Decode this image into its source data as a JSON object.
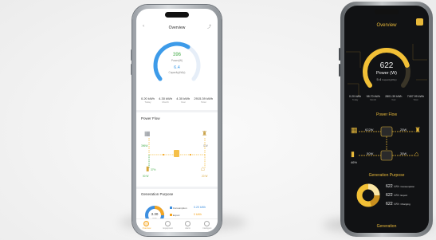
{
  "light_app": {
    "title": "Overview",
    "gauge": {
      "power_value": "396",
      "power_label": "Power(W)",
      "capacity_value": "6.4",
      "capacity_label": "Capacity(kWp)",
      "progress": 0.62
    },
    "stats": [
      {
        "value": "0.20 kWh",
        "label": "Today"
      },
      {
        "value": "4.30 kWh",
        "label": "Month"
      },
      {
        "value": "4.30 kWh",
        "label": "Year"
      },
      {
        "value": "2915.39 kWh",
        "label": "Total"
      }
    ],
    "power_flow_title": "Power Flow",
    "flow": {
      "solar": "396W",
      "grid": "0 W",
      "home": "0 W",
      "battery_pct": "37%",
      "battery_w": "50 W",
      "ev": "20 W"
    },
    "generation_title": "Generation Purpose",
    "donut_value": "3.30",
    "donut_unit": "kWh",
    "legend": [
      {
        "label": "Consumption",
        "value": "0.20 kWh",
        "color": "#3d8fe0"
      },
      {
        "label": "Export",
        "value": "0 kWh",
        "color": "#f5a623"
      }
    ],
    "nav": [
      "Overview",
      "Equipment",
      "Alarm",
      "Intelligent"
    ],
    "colors": {
      "accent": "#f5a623",
      "gauge": "#3d9be9",
      "green": "#4caf50"
    }
  },
  "dark_app": {
    "title": "Overview",
    "gauge": {
      "power_value": "622",
      "power_label": "Power (W)",
      "capacity_value": "5.4",
      "capacity_label": "Capacity(kWp)",
      "progress": 0.78
    },
    "stats": [
      {
        "value": "0.20 kWh",
        "label": "Today"
      },
      {
        "value": "98.70 kWh",
        "label": "Month"
      },
      {
        "value": "2801.39 kWh",
        "label": "Year"
      },
      {
        "value": "7407.99 kWh",
        "label": "Total"
      }
    ],
    "power_flow_title": "Power Flow",
    "flow": {
      "pv": "622W",
      "grid": "25W",
      "battery_pct": "46%",
      "battery_w": "50W",
      "home": "35W"
    },
    "generation_title": "Generation Purpose",
    "rows": [
      {
        "value": "622",
        "unit": "kWh",
        "name": "Consumption"
      },
      {
        "value": "622",
        "unit": "kWh",
        "name": "Export"
      },
      {
        "value": "622",
        "unit": "kWh",
        "name": "Charging"
      }
    ],
    "footer_title": "Generation",
    "colors": {
      "accent": "#e8b93a",
      "background": "#111214"
    }
  }
}
